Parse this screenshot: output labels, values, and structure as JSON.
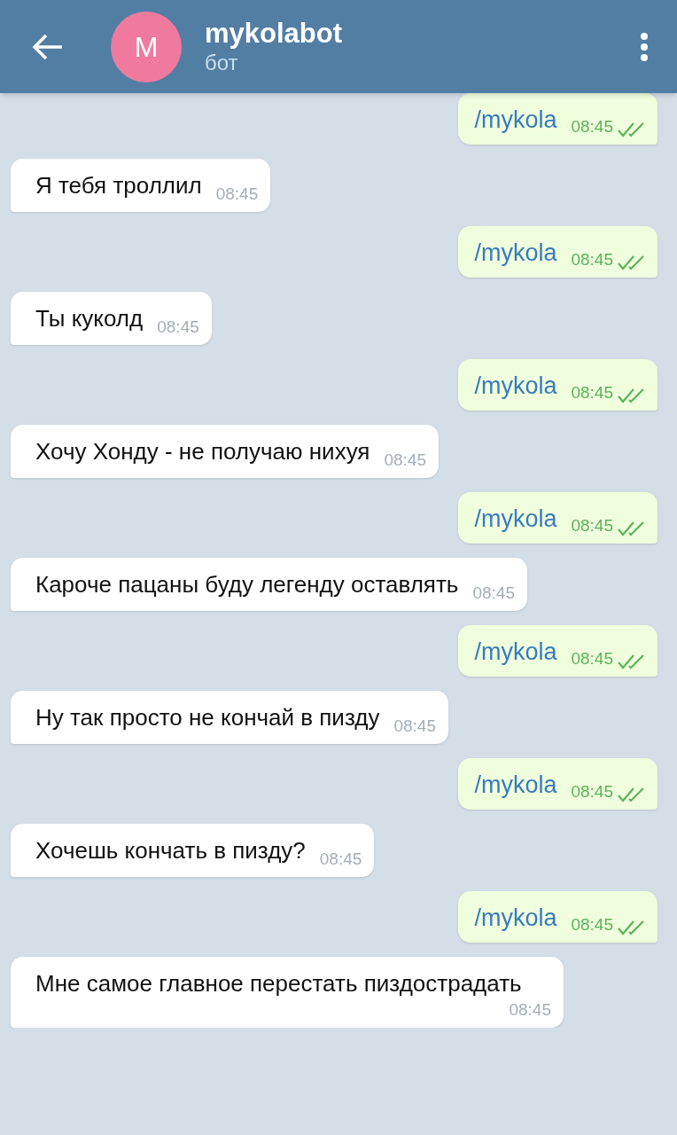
{
  "header": {
    "title": "mykolabot",
    "subtitle": "бот",
    "avatar_letter": "M"
  },
  "messages": [
    {
      "kind": "out",
      "text": "/mykola",
      "time": "08:45",
      "read": true
    },
    {
      "kind": "in",
      "text": "Я тебя троллил",
      "time": "08:45"
    },
    {
      "kind": "out",
      "text": "/mykola",
      "time": "08:45",
      "read": true
    },
    {
      "kind": "in",
      "text": "Ты куколд",
      "time": "08:45"
    },
    {
      "kind": "out",
      "text": "/mykola",
      "time": "08:45",
      "read": true
    },
    {
      "kind": "in",
      "text": "Хочу Хонду - не получаю нихуя",
      "time": "08:45"
    },
    {
      "kind": "out",
      "text": "/mykola",
      "time": "08:45",
      "read": true
    },
    {
      "kind": "in",
      "text": "Кароче пацаны буду легенду оставлять",
      "time": "08:45"
    },
    {
      "kind": "out",
      "text": "/mykola",
      "time": "08:45",
      "read": true
    },
    {
      "kind": "in",
      "text": "Ну так просто не кончай в пизду",
      "time": "08:45"
    },
    {
      "kind": "out",
      "text": "/mykola",
      "time": "08:45",
      "read": true
    },
    {
      "kind": "in",
      "text": "Хочешь кончать в пизду?",
      "time": "08:45"
    },
    {
      "kind": "out",
      "text": "/mykola",
      "time": "08:45",
      "read": true
    },
    {
      "kind": "in",
      "text": "Мне самое главное перестать пиздострадать",
      "time": "08:45"
    }
  ]
}
